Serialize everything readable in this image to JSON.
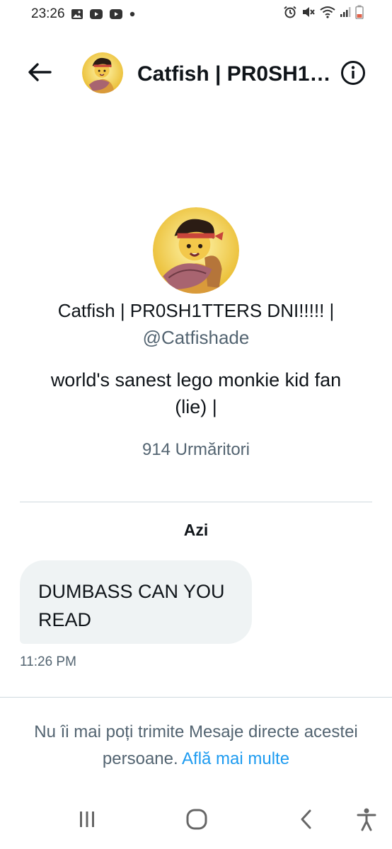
{
  "status_bar": {
    "time": "23:26",
    "left_icons": [
      "gallery-icon",
      "youtube-icon",
      "youtube-icon",
      "dot-icon"
    ],
    "right_icons": [
      "alarm-icon",
      "mute-icon",
      "wifi-icon",
      "signal-icon",
      "battery-icon"
    ]
  },
  "header": {
    "title": "Catfish | PR0SH1TTERS DNI!!!!! |",
    "back_icon": "arrow-left-icon",
    "info_icon": "info-icon"
  },
  "profile": {
    "name": "Catfish | PR0SH1TTERS DNI!!!!! |",
    "handle": "@Catfishade",
    "bio": "world's sanest lego monkie kid fan (lie) |",
    "followers": "914 Urmăritori"
  },
  "conversation": {
    "day_label": "Azi",
    "messages": [
      {
        "text": "DUMBASS CAN YOU READ",
        "time": "11:26 PM"
      }
    ]
  },
  "notice": {
    "text": "Nu îi mai poți trimite Mesaje directe acestei persoane.",
    "link": "Află mai multe"
  },
  "colors": {
    "primary_text": "#0f1419",
    "secondary_text": "#536471",
    "link": "#1d9bf0",
    "bubble": "#eff3f4",
    "divider": "#cfd9de"
  },
  "nav_bar": {
    "icons": [
      "recent-apps-icon",
      "home-icon",
      "back-icon",
      "accessibility-icon"
    ]
  }
}
